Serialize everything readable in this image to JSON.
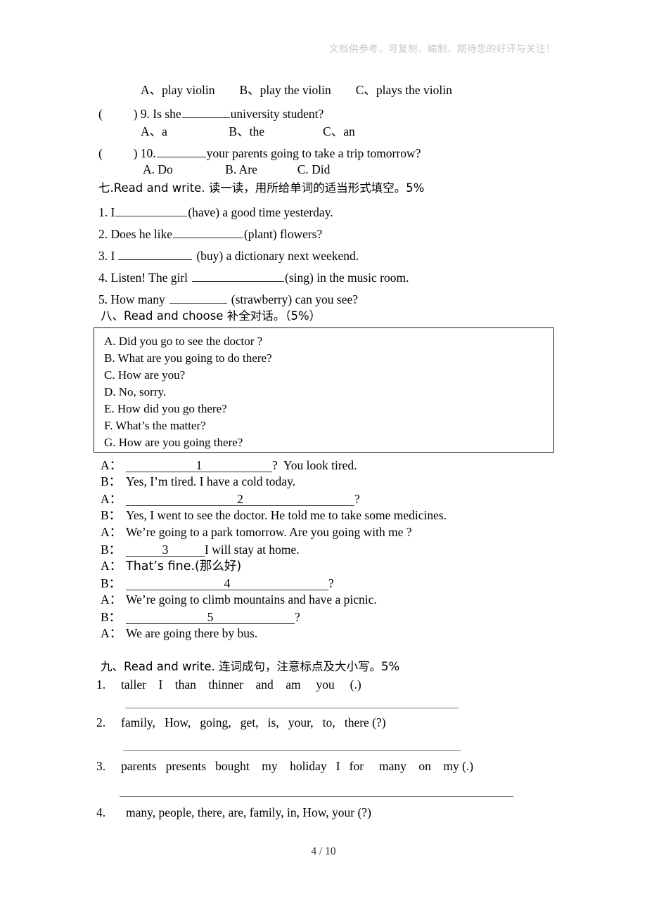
{
  "page": {
    "watermark": "文档供参考，可复制、编制，期待您的好评与关注！",
    "footer": "4 / 10"
  },
  "section_six_tail": {
    "q8_options": "A、play violin        B、play the violin        C、plays the violin",
    "q9": {
      "paren": "(          ) 9. Is she",
      "after_blank": "university student?",
      "options": "A、a                    B、the                   C、an"
    },
    "q10": {
      "paren": "(          ) 10.",
      "after_blank": "your parents going to take a trip tomorrow?",
      "options": "A. Do                 B. Are             C. Did"
    }
  },
  "section_seven": {
    "heading": "七.Read and write. 读一读，用所给单词的适当形式填空。5%",
    "items": [
      {
        "num": "1. I",
        "tail": "(have) a good time yesterday."
      },
      {
        "num": "2. Does he like",
        "tail": "(plant) flowers?"
      },
      {
        "num": "3. I",
        "tail": "(buy) a dictionary next weekend."
      },
      {
        "num": "4. Listen! The girl",
        "tail": "(sing) in the music room."
      },
      {
        "num": "5. How many",
        "tail": "(strawberry) can you see?"
      }
    ]
  },
  "section_eight": {
    "heading": "八、Read and choose 补全对话。（5%）",
    "choices": [
      "A. Did you go to see the doctor ?",
      "B. What are you going to do there?",
      "C. How are you?",
      "D. No, sorry.",
      "E. How did you go there?",
      "F. What’s the matter?",
      "G. How are you going there?"
    ],
    "dialogue": [
      {
        "speaker": "A：",
        "blank": "1",
        "tail": "?  You look tired."
      },
      {
        "speaker": "B：",
        "text": "Yes, I’m tired. I have a cold today."
      },
      {
        "speaker": "A：",
        "blank": "2",
        "tail": "?"
      },
      {
        "speaker": "B：",
        "text": "Yes, I went to see the doctor. He told me to take some medicines."
      },
      {
        "speaker": "A：",
        "text": "We’re going to a park tomorrow. Are you going with me ?"
      },
      {
        "speaker": "B：",
        "blank": "3",
        "tail": "I will stay at home."
      },
      {
        "speaker": "A：",
        "text": "That’s fine.(那么好)"
      },
      {
        "speaker": "B：",
        "blank": "4",
        "tail": "?"
      },
      {
        "speaker": "A：",
        "text": "We’re going to climb mountains and have a picnic."
      },
      {
        "speaker": "B：",
        "blank": "5",
        "tail": "?"
      },
      {
        "speaker": "A：",
        "text": "We are going there by bus."
      }
    ]
  },
  "section_nine": {
    "heading": "九、Read and write. 连词成句，注意标点及大小写。5%",
    "items": [
      {
        "num": "1.",
        "words": "taller    I    than    thinner    and    am     you     (.)"
      },
      {
        "num": "2.",
        "words": "family,   How,   going,   get,   is,   your,   to,   there (?)"
      },
      {
        "num": "3.",
        "words": "parents   presents   bought    my    holiday   I   for     many    on    my (.)"
      },
      {
        "num": "4.",
        "words": "many, people, there, are, family, in, How, your (?)"
      }
    ]
  }
}
